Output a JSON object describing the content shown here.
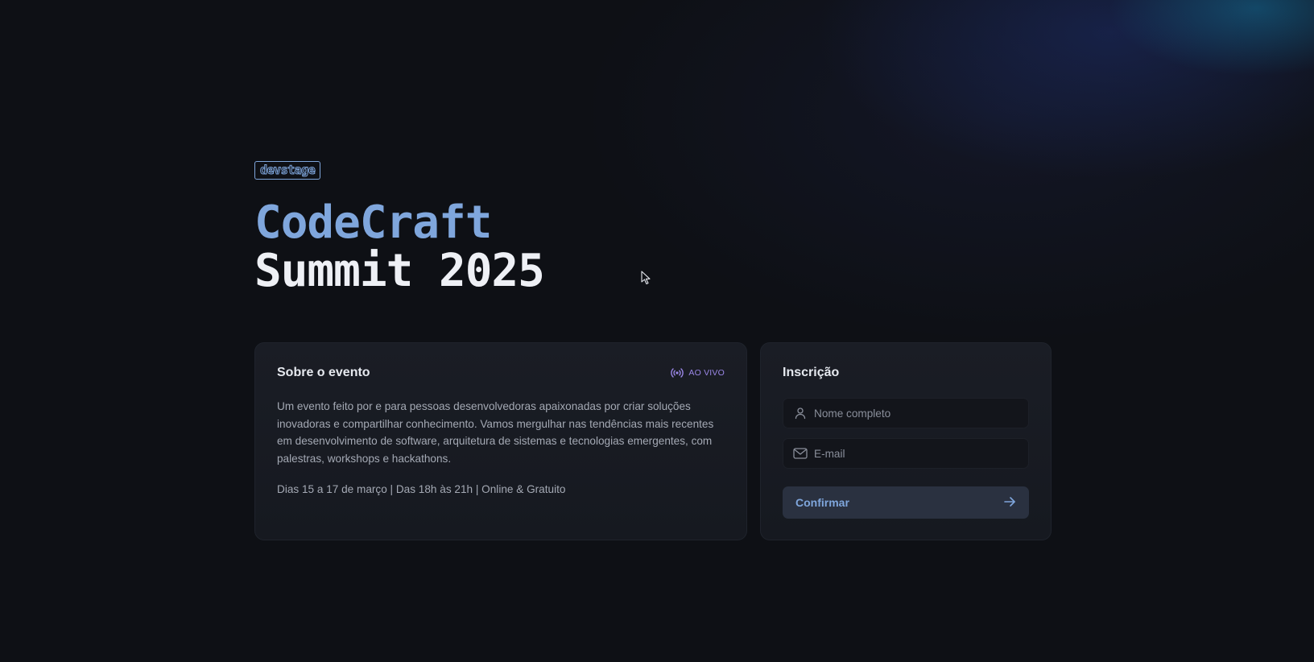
{
  "brand": {
    "logo_text": "devstage"
  },
  "hero": {
    "title_line1": "CodeCraft",
    "title_line2": "Summit 2025"
  },
  "about": {
    "title": "Sobre o evento",
    "live_label": "AO VIVO",
    "live_icon": "broadcast-icon",
    "description": "Um evento feito por e para pessoas desenvolvedoras apaixonadas por criar soluções inovadoras e compartilhar conhecimento. Vamos mergulhar nas tendências mais recentes em desenvolvimento de software, arquitetura de sistemas e tecnologias emergentes, com palestras, workshops e hackathons.",
    "details": "Dias 15 a 17 de março | Das 18h às 21h | Online & Gratuito"
  },
  "signup": {
    "title": "Inscrição",
    "name_field": {
      "placeholder": "Nome completo",
      "value": "",
      "icon": "user-icon"
    },
    "email_field": {
      "placeholder": "E-mail",
      "value": "",
      "icon": "mail-icon"
    },
    "submit_label": "Confirmar",
    "submit_icon": "arrow-right-icon"
  },
  "colors": {
    "background": "#0e1015",
    "accent_blue": "#7fa6dc",
    "accent_purple": "#9a86e6",
    "card": "#1a1d25",
    "text_muted": "#a4a9b4"
  }
}
